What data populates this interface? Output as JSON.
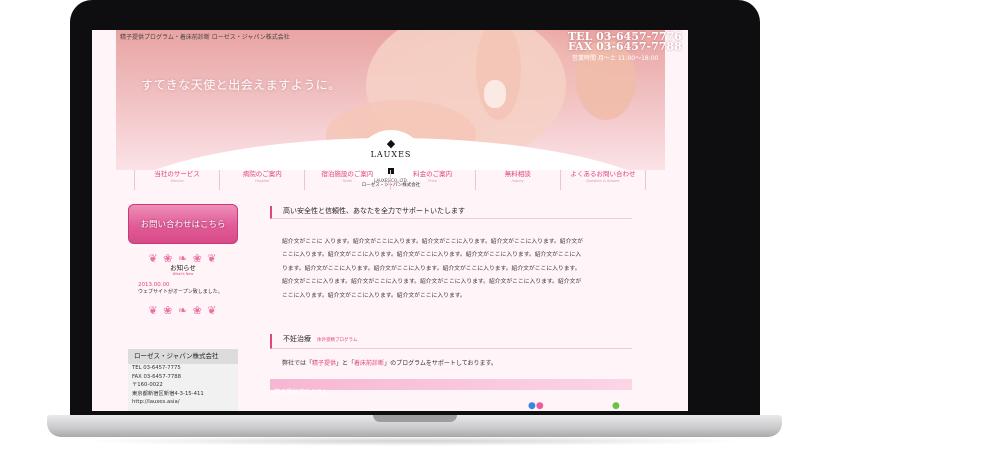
{
  "site": {
    "top_text": "精子提供プログラム・着床前診断 ローゼス・ジャパン株式会社",
    "tel": "TEL 03-6457-7776",
    "fax": "FAX 03-6457-7788",
    "hours": "営業時間 月〜土 11:00〜18:00",
    "tagline": "すてきな天使と出会えますように。",
    "logo": {
      "name": "LAUXES",
      "sub": "LAUXES.CO.,LTD.",
      "company": "ローゼス・ジャパン株式会社"
    },
    "nav": [
      {
        "label": "当社のサービス",
        "sub": "Service"
      },
      {
        "label": "病院のご案内",
        "sub": "Hospital"
      },
      {
        "label": "宿泊施設のご案内",
        "sub": "Hotel"
      },
      {
        "label": "料金のご案内",
        "sub": "Price"
      },
      {
        "label": "無料相談",
        "sub": "Inquiry"
      },
      {
        "label": "よくあるお問い合わせ",
        "sub": "Question & Answer"
      }
    ],
    "sidebar": {
      "contact_label": "お問い合わせはこちら",
      "news_title": "お知らせ",
      "news_sub": "What's New",
      "news_date": "2013.00.00",
      "news_text": "ウェブサイトがオープン致しました。",
      "company_name": "ローゼス・ジャパン株式会社",
      "company_lines": [
        "TEL 03-6457-7775",
        "FAX 03-6457-7788",
        "〒160-0022",
        "東京都新宿区新宿4-3-15-411",
        "http://lauxes.asia/"
      ]
    },
    "main": {
      "heading": "高い安全性と信頼性、あなたを全力でサポートいたします",
      "intro_lines": [
        "紹介文がここに 入ります。紹介文がここに入ります。紹介文がここに入ります。紹介文がここに入ります。紹介文が",
        "ここに入ります。紹介文がここに入ります。紹介文がここに入ります。紹介文がここに入ります。紹介文がここに入",
        "ります。紹介文がここに入ります。紹介文がここに入ります。紹介文がここに入ります。紹介文がここに入ります。",
        "紹介文がここに入ります。紹介文がここに入ります。紹介文がここに入ります。紹介文がここに入ります。紹介文が",
        "ここに入ります。紹介文がここに入ります。紹介文がここに入ります。"
      ],
      "heading2": "不妊治療",
      "heading2_sub": "体外受精プログラム",
      "program_before": "弊社では「",
      "program_link1": "精子提供",
      "program_mid": "」と「",
      "program_link2": "着床前診断",
      "program_after": "」のプログラムをサポートしております。",
      "bar_label": "精子提供プログラム"
    }
  },
  "colors": {
    "accent": "#e0457d",
    "bar": "#f7b6d3",
    "frame": "#0e0e10"
  }
}
